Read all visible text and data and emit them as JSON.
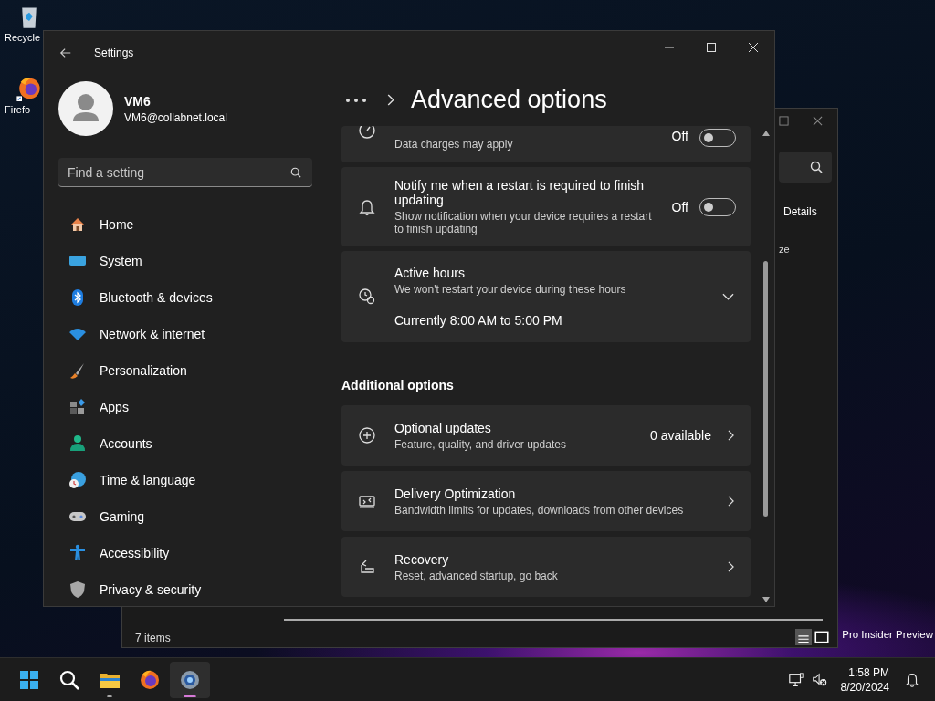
{
  "desktop": {
    "icons": [
      {
        "label": "Recycle"
      },
      {
        "label": "Firefo"
      }
    ],
    "watermark": "Pro Insider Preview"
  },
  "explorer": {
    "details_button": "Details",
    "column_header": "ze",
    "status": "7 items"
  },
  "settings": {
    "title": "Settings",
    "user": {
      "name": "VM6",
      "email": "VM6@collabnet.local"
    },
    "search": {
      "placeholder": "Find a setting"
    },
    "nav": [
      {
        "label": "Home"
      },
      {
        "label": "System"
      },
      {
        "label": "Bluetooth & devices"
      },
      {
        "label": "Network & internet"
      },
      {
        "label": "Personalization"
      },
      {
        "label": "Apps"
      },
      {
        "label": "Accounts"
      },
      {
        "label": "Time & language"
      },
      {
        "label": "Gaming"
      },
      {
        "label": "Accessibility"
      },
      {
        "label": "Privacy & security"
      }
    ],
    "page_title": "Advanced options",
    "rows": [
      {
        "kind": "toggle",
        "subtitle": "Data charges may apply",
        "state_text": "Off",
        "on": false
      },
      {
        "kind": "toggle",
        "title": "Notify me when a restart is required to finish updating",
        "subtitle": "Show notification when your device requires a restart to finish updating",
        "state_text": "Off",
        "on": false
      },
      {
        "kind": "expander",
        "title": "Active hours",
        "subtitle": "We won't restart your device during these hours",
        "value": "Currently 8:00 AM to 5:00 PM",
        "expanded": false
      }
    ],
    "section": "Additional options",
    "links": [
      {
        "title": "Optional updates",
        "subtitle": "Feature, quality, and driver updates",
        "value": "0 available"
      },
      {
        "title": "Delivery Optimization",
        "subtitle": "Bandwidth limits for updates, downloads from other devices"
      },
      {
        "title": "Recovery",
        "subtitle": "Reset, advanced startup, go back"
      }
    ]
  },
  "taskbar": {
    "apps": [
      {
        "running": false,
        "selected": false
      },
      {
        "running": false,
        "selected": false
      },
      {
        "running": true,
        "selected": false
      },
      {
        "running": false,
        "selected": false
      },
      {
        "running": true,
        "selected": true
      }
    ],
    "clock": {
      "time": "1:58 PM",
      "date": "8/20/2024"
    }
  }
}
